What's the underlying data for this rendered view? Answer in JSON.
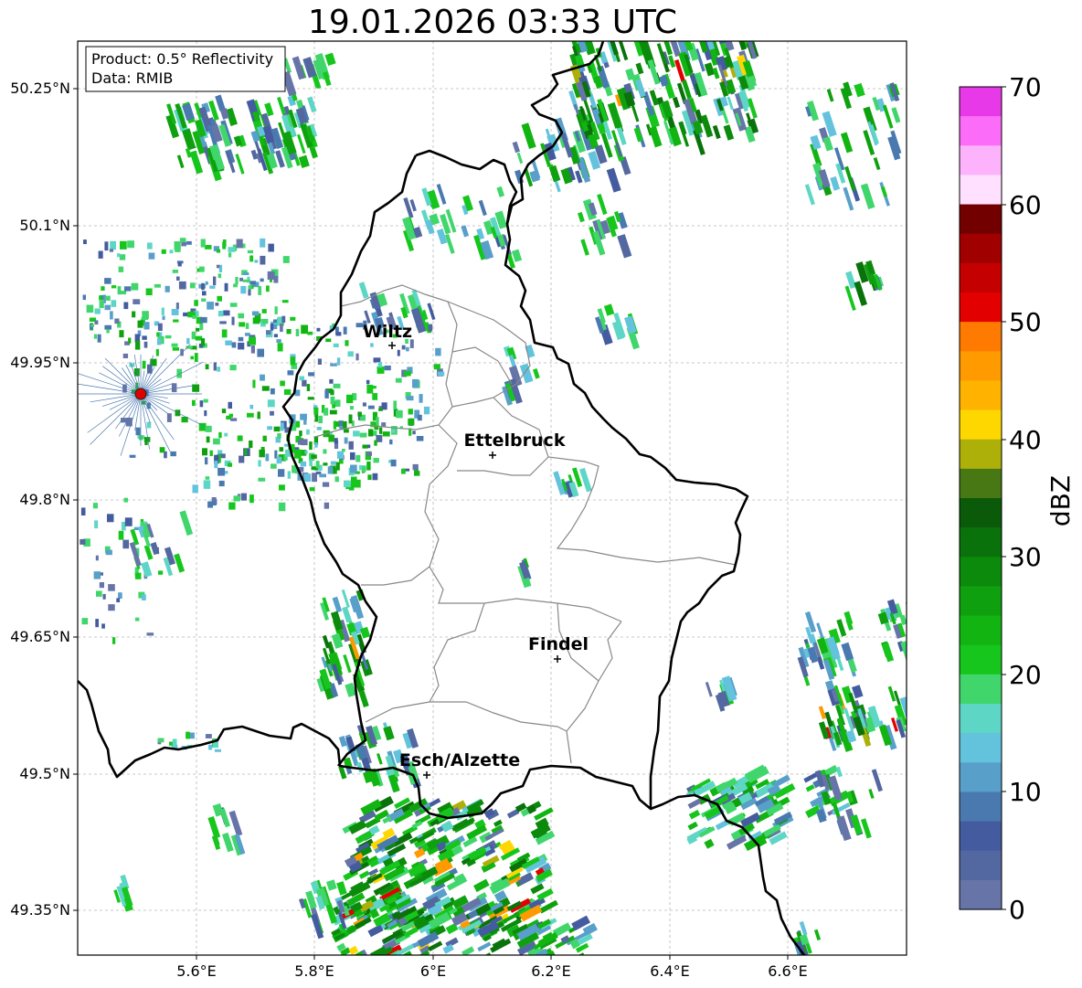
{
  "title": "19.01.2026 03:33 UTC",
  "info": {
    "product_line": "Product: 0.5° Reflectivity",
    "data_line": "Data: RMIB"
  },
  "axes": {
    "x_ticks": [
      "5.6°E",
      "5.8°E",
      "6°E",
      "6.2°E",
      "6.4°E",
      "6.6°E"
    ],
    "y_ticks": [
      "50.25°N",
      "50.1°N",
      "49.95°N",
      "49.8°N",
      "49.65°N",
      "49.5°N",
      "49.35°N"
    ]
  },
  "colorbar": {
    "label": "dBZ",
    "ticks": [
      "70",
      "60",
      "50",
      "40",
      "30",
      "20",
      "10",
      "0"
    ],
    "colors": [
      "#e839e8",
      "#fb6cf8",
      "#fdb3fc",
      "#ffe0ff",
      "#730000",
      "#a10000",
      "#c40000",
      "#e30000",
      "#ff7a00",
      "#ff9a00",
      "#ffb300",
      "#ffd700",
      "#aeb00a",
      "#487814",
      "#0a5a0a",
      "#0a720a",
      "#0c8a0c",
      "#0fa00f",
      "#12b412",
      "#17c61d",
      "#41d66c",
      "#5ed6c6",
      "#63c3dd",
      "#589fca",
      "#4a79b0",
      "#445c9f",
      "#5367a0",
      "#6674a8"
    ]
  },
  "cities": [
    {
      "name": "Wiltz"
    },
    {
      "name": "Ettelbruck"
    },
    {
      "name": "Findel"
    },
    {
      "name": "Esch/Alzette"
    }
  ],
  "radar_site_color": "#e00000",
  "border_color": "#000000",
  "canton_color": "#888888"
}
